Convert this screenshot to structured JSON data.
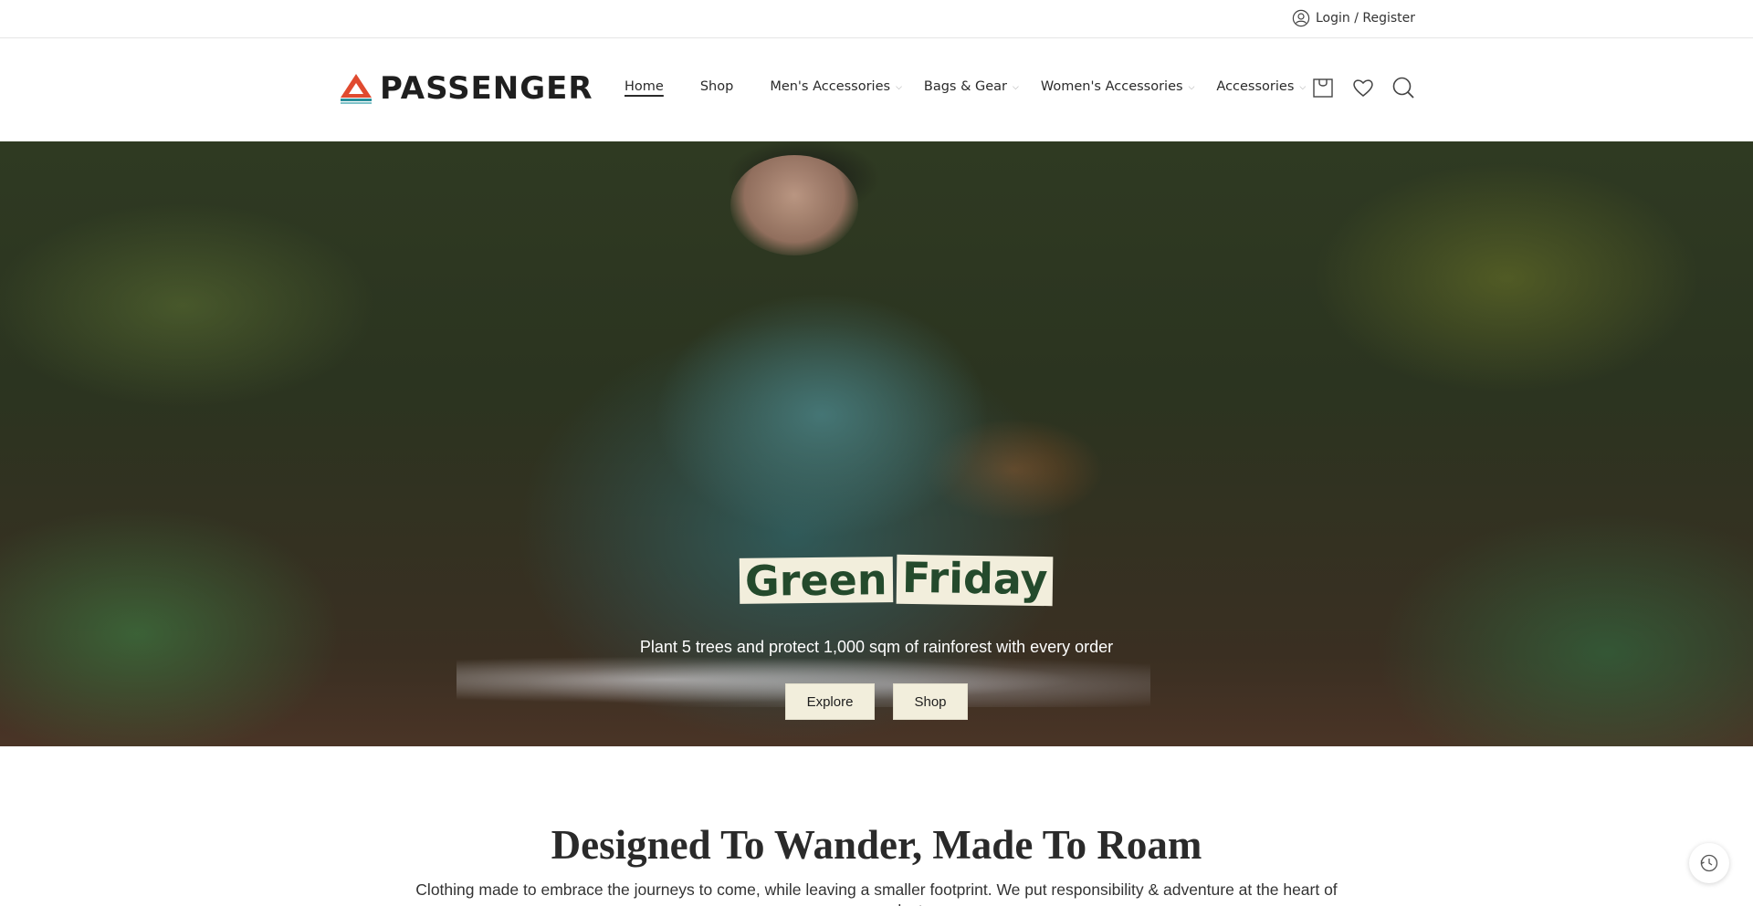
{
  "topbar": {
    "login_label": "Login / Register"
  },
  "brand": {
    "name": "PASSENGER"
  },
  "nav": {
    "items": [
      {
        "label": "Home",
        "has_dropdown": false,
        "active": true
      },
      {
        "label": "Shop",
        "has_dropdown": false,
        "active": false
      },
      {
        "label": "Men's Accessories",
        "has_dropdown": true,
        "active": false
      },
      {
        "label": "Bags & Gear",
        "has_dropdown": true,
        "active": false
      },
      {
        "label": "Women's Accessories",
        "has_dropdown": true,
        "active": false
      },
      {
        "label": "Accessories",
        "has_dropdown": true,
        "active": false
      }
    ]
  },
  "header_icons": [
    "cart-icon",
    "heart-icon",
    "search-icon"
  ],
  "hero": {
    "headline_word_1": "Green",
    "headline_word_2": "Friday",
    "subtitle": "Plant 5 trees and protect 1,000 sqm of rainforest with every order",
    "buttons": {
      "explore": "Explore",
      "shop": "Shop"
    }
  },
  "intro": {
    "title": "Designed To Wander, Made To Roam",
    "text": "Clothing made to embrace the journeys to come, while leaving a smaller footprint. We put responsibility & adventure at the heart of every product."
  },
  "colors": {
    "accent_cream": "#f2eedc",
    "headline_green": "#244a2c",
    "logo_red": "#e04a2f",
    "logo_teal": "#2a8f9a"
  }
}
